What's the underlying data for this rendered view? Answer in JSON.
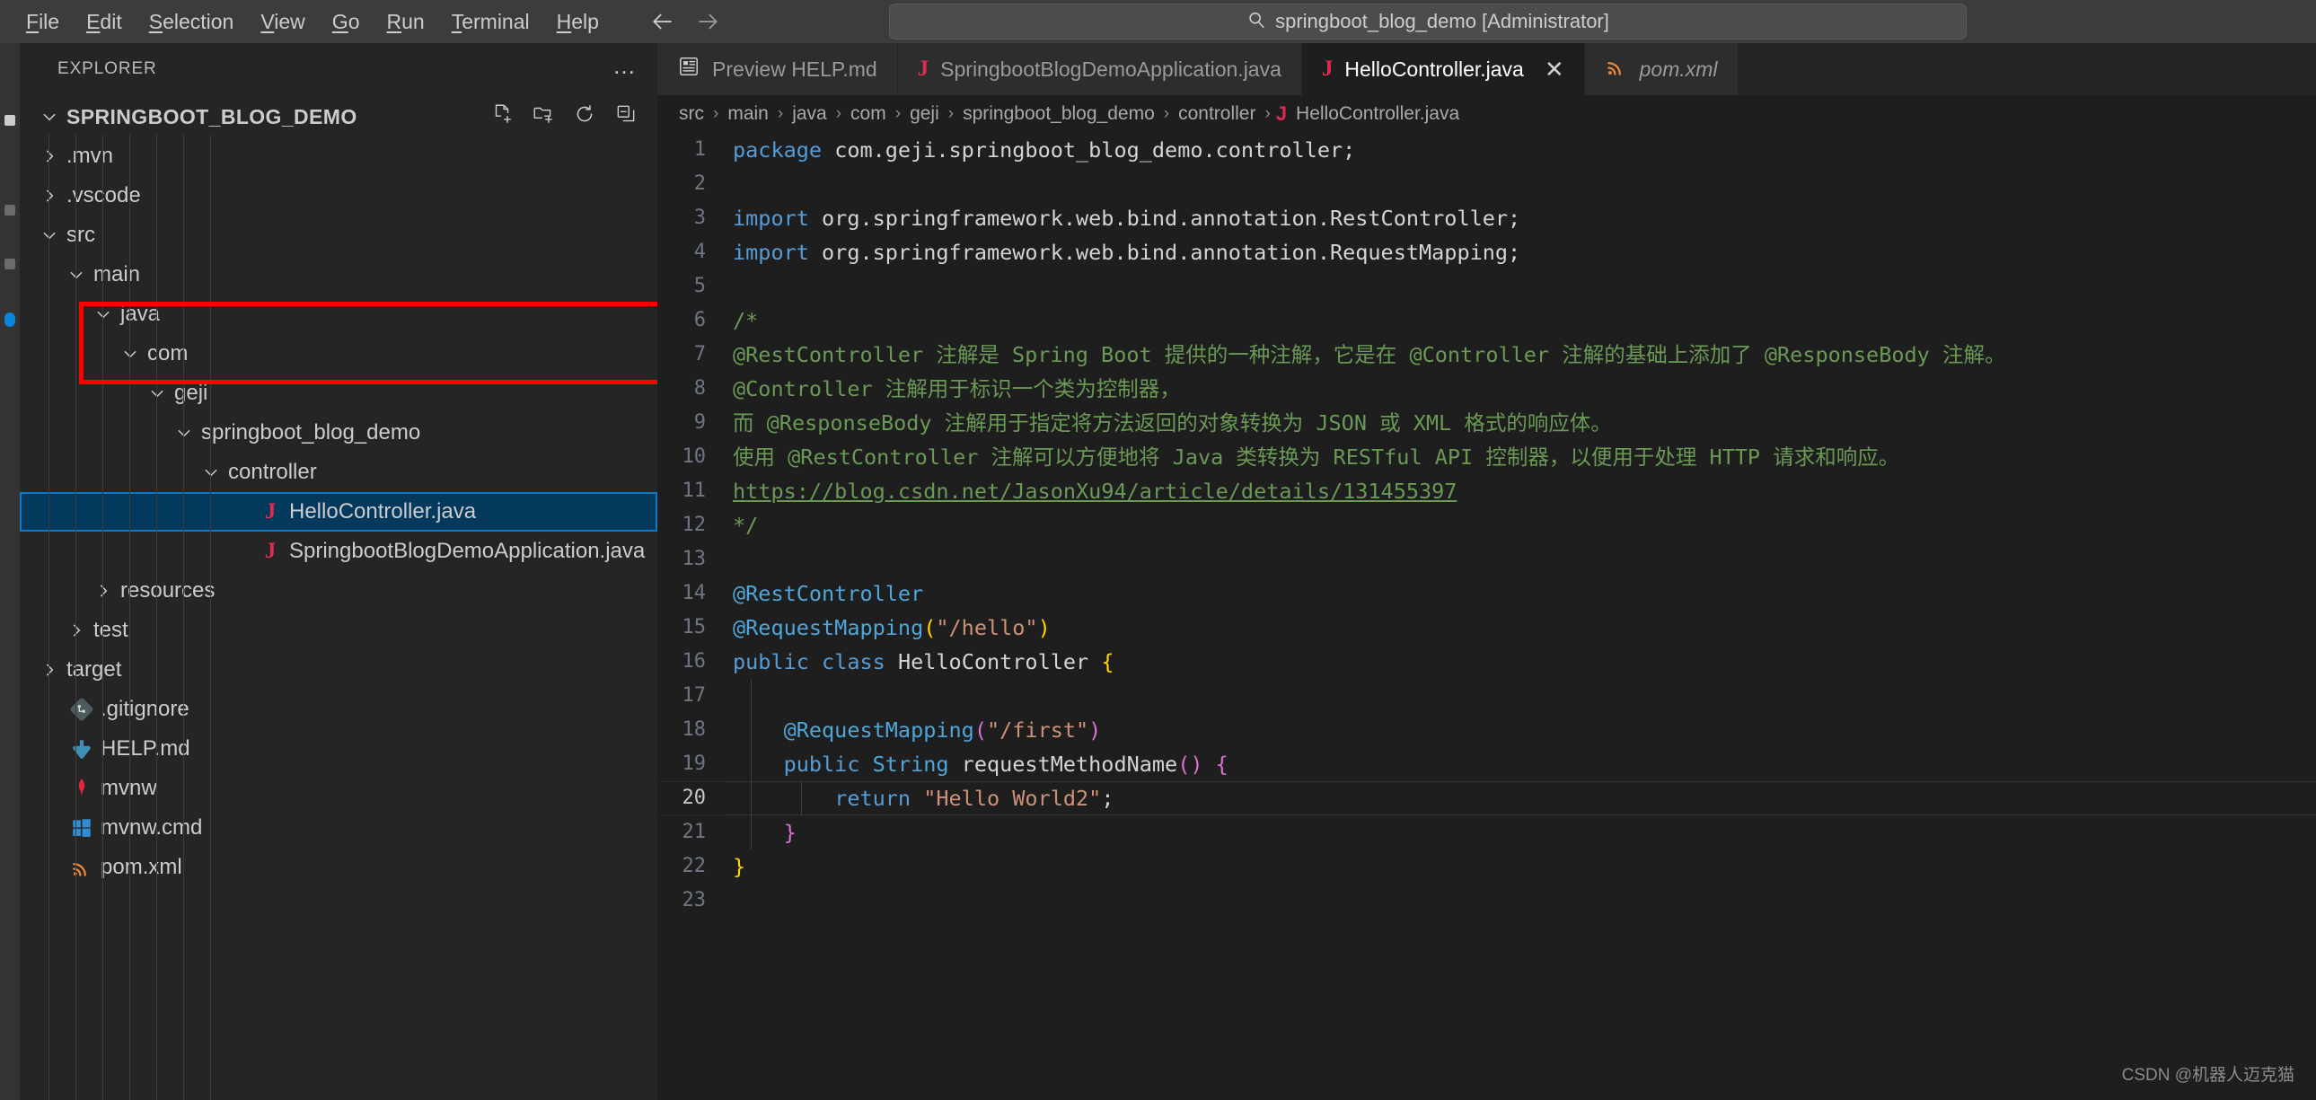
{
  "titlebar": {
    "menu": [
      {
        "label": "File",
        "mnemonic": "F"
      },
      {
        "label": "Edit",
        "mnemonic": "E"
      },
      {
        "label": "Selection",
        "mnemonic": "S"
      },
      {
        "label": "View",
        "mnemonic": "V"
      },
      {
        "label": "Go",
        "mnemonic": "G"
      },
      {
        "label": "Run",
        "mnemonic": "R"
      },
      {
        "label": "Terminal",
        "mnemonic": "T"
      },
      {
        "label": "Help",
        "mnemonic": "H"
      }
    ],
    "back_icon": "arrow-left-icon",
    "forward_icon": "arrow-right-icon",
    "search_icon": "search-icon",
    "search_value": "springboot_blog_demo [Administrator]"
  },
  "sidebar": {
    "header": "EXPLORER",
    "more_actions": "…",
    "actions": [
      {
        "name": "new-file-icon",
        "tooltip": "New File"
      },
      {
        "name": "new-folder-icon",
        "tooltip": "New Folder"
      },
      {
        "name": "refresh-icon",
        "tooltip": "Refresh Explorer"
      },
      {
        "name": "collapse-all-icon",
        "tooltip": "Collapse Folders in Explorer"
      }
    ],
    "root": "SPRINGBOOT_BLOG_DEMO",
    "tree": [
      {
        "label": ".mvn",
        "type": "folder",
        "expanded": false,
        "indent": 1
      },
      {
        "label": ".vscode",
        "type": "folder",
        "expanded": false,
        "indent": 1
      },
      {
        "label": "src",
        "type": "folder",
        "expanded": true,
        "indent": 1
      },
      {
        "label": "main",
        "type": "folder",
        "expanded": true,
        "indent": 2
      },
      {
        "label": "java",
        "type": "folder",
        "expanded": true,
        "indent": 3
      },
      {
        "label": "com",
        "type": "folder",
        "expanded": true,
        "indent": 4
      },
      {
        "label": "geji",
        "type": "folder",
        "expanded": true,
        "indent": 5
      },
      {
        "label": "springboot_blog_demo",
        "type": "folder",
        "expanded": true,
        "indent": 6
      },
      {
        "label": "controller",
        "type": "folder",
        "expanded": true,
        "indent": 7,
        "annotated": true
      },
      {
        "label": "HelloController.java",
        "type": "java",
        "indent": 8,
        "selected": true,
        "annotated": true
      },
      {
        "label": "SpringbootBlogDemoApplication.java",
        "type": "java",
        "indent": 8
      },
      {
        "label": "resources",
        "type": "folder",
        "expanded": false,
        "indent": 3
      },
      {
        "label": "test",
        "type": "folder",
        "expanded": false,
        "indent": 2
      },
      {
        "label": "target",
        "type": "folder",
        "expanded": false,
        "indent": 1
      },
      {
        "label": ".gitignore",
        "type": "git",
        "indent": 1
      },
      {
        "label": "HELP.md",
        "type": "md",
        "indent": 1
      },
      {
        "label": "mvnw",
        "type": "maven",
        "indent": 1
      },
      {
        "label": "mvnw.cmd",
        "type": "windows",
        "indent": 1
      },
      {
        "label": "pom.xml",
        "type": "xml",
        "indent": 1
      }
    ]
  },
  "tabs": [
    {
      "label": "Preview HELP.md",
      "icon": "preview-icon",
      "active": false,
      "preview": false,
      "closable": false
    },
    {
      "label": "SpringbootBlogDemoApplication.java",
      "icon": "java-icon",
      "active": false,
      "preview": false,
      "closable": false
    },
    {
      "label": "HelloController.java",
      "icon": "java-icon",
      "active": true,
      "preview": false,
      "closable": true,
      "close_label": "✕"
    },
    {
      "label": "pom.xml",
      "icon": "xml-icon",
      "active": false,
      "preview": true,
      "closable": false
    }
  ],
  "breadcrumb": {
    "separator": "›",
    "segments": [
      "src",
      "main",
      "java",
      "com",
      "geji",
      "springboot_blog_demo",
      "controller"
    ],
    "file_icon": "J",
    "file": "HelloController.java"
  },
  "editor": {
    "current_line": 20,
    "total_lines": 23,
    "lines": [
      {
        "n": 1,
        "tokens": [
          {
            "t": "package",
            "c": "k"
          },
          {
            "t": " com.geji.springboot_blog_demo.controller;",
            "c": "plain"
          }
        ]
      },
      {
        "n": 2,
        "tokens": []
      },
      {
        "n": 3,
        "tokens": [
          {
            "t": "import",
            "c": "k"
          },
          {
            "t": " org.springframework.web.bind.annotation.RestController;",
            "c": "plain"
          }
        ]
      },
      {
        "n": 4,
        "tokens": [
          {
            "t": "import",
            "c": "k"
          },
          {
            "t": " org.springframework.web.bind.annotation.RequestMapping;",
            "c": "plain"
          }
        ]
      },
      {
        "n": 5,
        "tokens": []
      },
      {
        "n": 6,
        "tokens": [
          {
            "t": "/*",
            "c": "cmt"
          }
        ]
      },
      {
        "n": 7,
        "tokens": [
          {
            "t": "@RestController 注解是 Spring Boot 提供的一种注解，它是在 @Controller 注解的基础上添加了 @ResponseBody 注解。",
            "c": "cmt"
          }
        ]
      },
      {
        "n": 8,
        "tokens": [
          {
            "t": "@Controller 注解用于标识一个类为控制器，",
            "c": "cmt"
          }
        ]
      },
      {
        "n": 9,
        "tokens": [
          {
            "t": "而 @ResponseBody 注解用于指定将方法返回的对象转换为 JSON 或 XML 格式的响应体。",
            "c": "cmt"
          }
        ]
      },
      {
        "n": 10,
        "tokens": [
          {
            "t": "使用 @RestController 注解可以方便地将 Java 类转换为 RESTful API 控制器，以便用于处理 HTTP 请求和响应。",
            "c": "cmt"
          }
        ]
      },
      {
        "n": 11,
        "tokens": [
          {
            "t": "https://blog.csdn.net/JasonXu94/article/details/131455397",
            "c": "lnk"
          }
        ]
      },
      {
        "n": 12,
        "tokens": [
          {
            "t": "*/",
            "c": "cmt"
          }
        ]
      },
      {
        "n": 13,
        "tokens": []
      },
      {
        "n": 14,
        "tokens": [
          {
            "t": "@RestController",
            "c": "anno-blue"
          }
        ]
      },
      {
        "n": 15,
        "tokens": [
          {
            "t": "@RequestMapping",
            "c": "anno-blue"
          },
          {
            "t": "(",
            "c": "by"
          },
          {
            "t": "\"/hello\"",
            "c": "str"
          },
          {
            "t": ")",
            "c": "by"
          }
        ]
      },
      {
        "n": 16,
        "tokens": [
          {
            "t": "public",
            "c": "k"
          },
          {
            "t": " ",
            "c": "plain"
          },
          {
            "t": "class",
            "c": "k"
          },
          {
            "t": " ",
            "c": "plain"
          },
          {
            "t": "HelloController",
            "c": "plain"
          },
          {
            "t": " ",
            "c": "plain"
          },
          {
            "t": "{",
            "c": "by"
          }
        ]
      },
      {
        "n": 17,
        "tokens": []
      },
      {
        "n": 18,
        "tokens": [
          {
            "t": "    ",
            "c": "plain"
          },
          {
            "t": "@RequestMapping",
            "c": "anno-blue"
          },
          {
            "t": "(",
            "c": "bm"
          },
          {
            "t": "\"/first\"",
            "c": "str"
          },
          {
            "t": ")",
            "c": "bm"
          }
        ]
      },
      {
        "n": 19,
        "tokens": [
          {
            "t": "    ",
            "c": "plain"
          },
          {
            "t": "public",
            "c": "k"
          },
          {
            "t": " ",
            "c": "plain"
          },
          {
            "t": "String",
            "c": "anno-blue"
          },
          {
            "t": " requestMethodName",
            "c": "plain"
          },
          {
            "t": "()",
            "c": "bm"
          },
          {
            "t": " ",
            "c": "plain"
          },
          {
            "t": "{",
            "c": "bm"
          }
        ]
      },
      {
        "n": 20,
        "tokens": [
          {
            "t": "        ",
            "c": "plain"
          },
          {
            "t": "return",
            "c": "k"
          },
          {
            "t": " ",
            "c": "plain"
          },
          {
            "t": "\"Hello World2\"",
            "c": "str"
          },
          {
            "t": ";",
            "c": "plain"
          }
        ]
      },
      {
        "n": 21,
        "tokens": [
          {
            "t": "    ",
            "c": "plain"
          },
          {
            "t": "}",
            "c": "bm"
          }
        ]
      },
      {
        "n": 22,
        "tokens": [
          {
            "t": "}",
            "c": "by"
          }
        ]
      },
      {
        "n": 23,
        "tokens": []
      }
    ]
  },
  "watermark": "CSDN @机器人迈克猫",
  "colors": {
    "titlebar_bg": "#3c3c3c",
    "sidebar_bg": "#252526",
    "editor_bg": "#1e1e1e",
    "selection_bg": "#04395e",
    "selection_border": "#0a7aca",
    "annotation": "#ff0000",
    "keyword": "#569cd6",
    "comment": "#6a9955",
    "string": "#ce9178",
    "java_icon": "#e02b4f"
  }
}
